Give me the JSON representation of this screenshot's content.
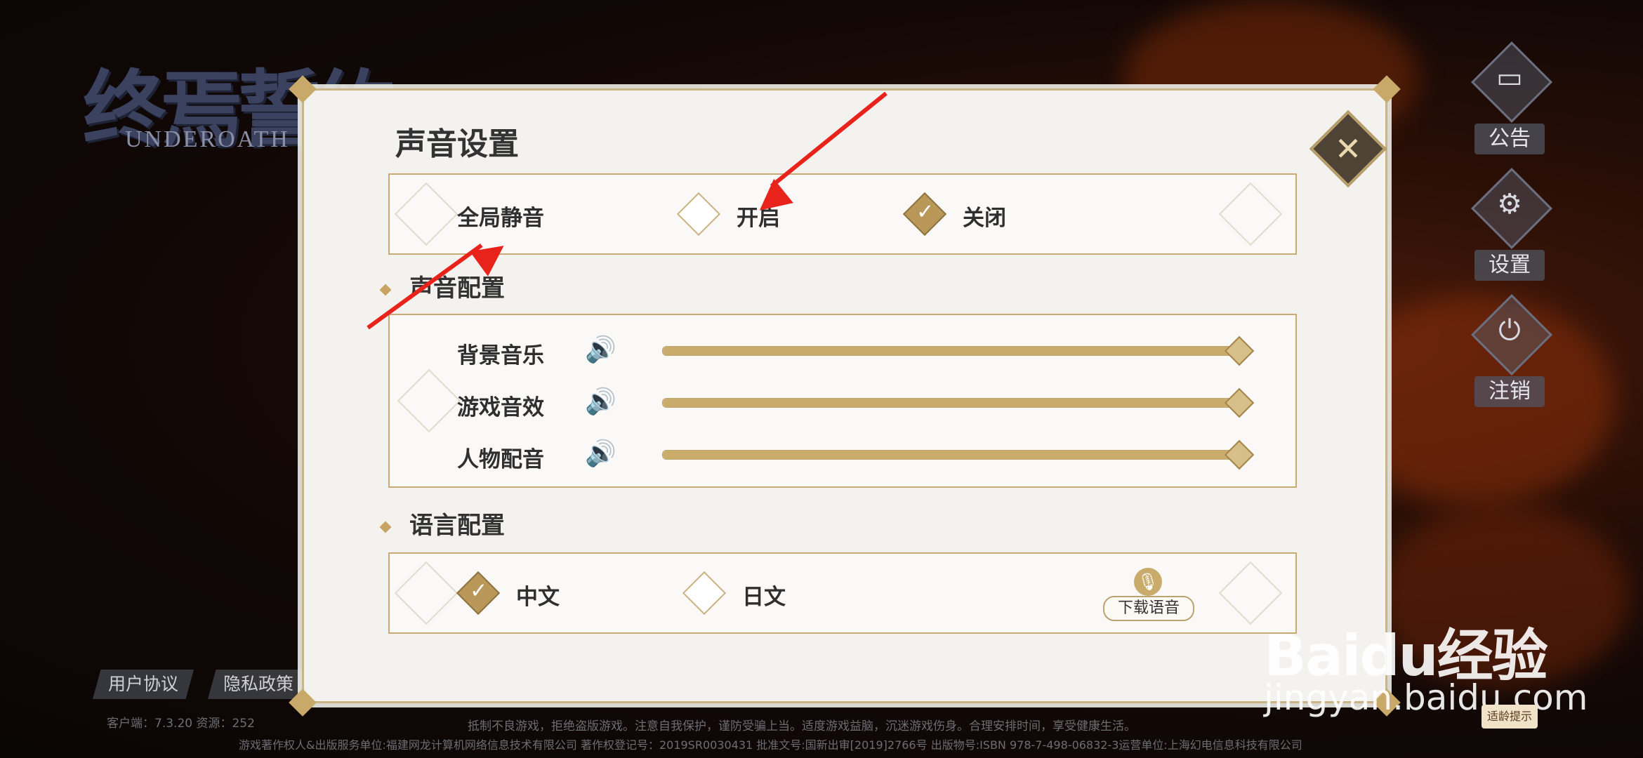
{
  "logo": {
    "title_cn": "终焉誓约",
    "title_en": "UNDEROATH"
  },
  "side_buttons": [
    {
      "label": "公告",
      "icon": "notice-icon"
    },
    {
      "label": "设置",
      "icon": "gear-icon"
    },
    {
      "label": "注销",
      "icon": "power-icon"
    }
  ],
  "footer": {
    "user_agreement": "用户协议",
    "privacy_policy": "隐私政策",
    "client_version": "客户端：7.3.20  资源：252",
    "health_notice": "抵制不良游戏，拒绝盗版游戏。注意自我保护，谨防受骗上当。适度游戏益脑，沉迷游戏伤身。合理安排时间，享受健康生活。",
    "copyright_line": "游戏著作权人&出版服务单位:福建网龙计算机网络信息技术有限公司  著作权登记号：2019SR0030431  批准文号:国新出审[2019]2766号  出版物号:ISBN 978-7-498-06832-3运营单位:上海幻电信息科技有限公司"
  },
  "panel": {
    "title": "声音设置",
    "close_label": "✕",
    "global_mute": {
      "label": "全局静音",
      "options": [
        {
          "label": "开启",
          "selected": false
        },
        {
          "label": "关闭",
          "selected": true
        }
      ]
    },
    "sound_section": {
      "heading": "声音配置",
      "rows": [
        {
          "label": "背景音乐",
          "value_percent": 100
        },
        {
          "label": "游戏音效",
          "value_percent": 100
        },
        {
          "label": "人物配音",
          "value_percent": 100
        }
      ]
    },
    "language_section": {
      "heading": "语言配置",
      "options": [
        {
          "label": "中文",
          "selected": true
        },
        {
          "label": "日文",
          "selected": false
        }
      ],
      "download_label": "下载语音"
    }
  },
  "watermark": {
    "logo": "Baidu经验",
    "url": "jingyan.baidu.com"
  },
  "age_badge": "适龄提示",
  "colors": {
    "accent_gold": "#c9ab6c",
    "arrow_red": "#e8231b",
    "panel_bg": "#f3f2ef"
  }
}
